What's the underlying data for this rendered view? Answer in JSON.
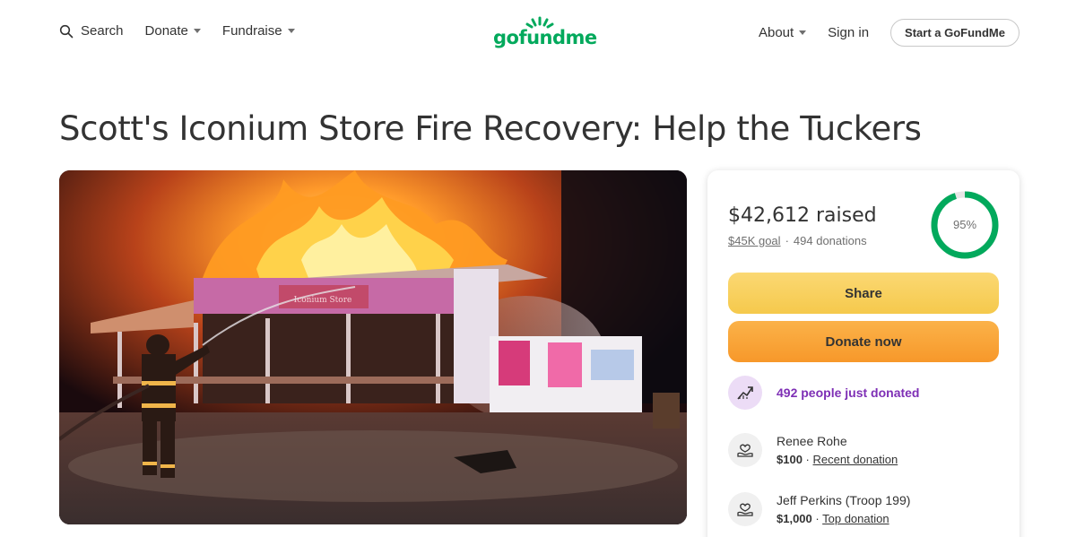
{
  "nav": {
    "search_label": "Search",
    "donate_label": "Donate",
    "fundraise_label": "Fundraise",
    "logo_text": "gofundme",
    "about_label": "About",
    "signin_label": "Sign in",
    "start_label": "Start a GoFundMe"
  },
  "campaign": {
    "title": "Scott's Iconium Store Fire Recovery: Help the Tuckers",
    "store_sign": "Iconium Store"
  },
  "donation_card": {
    "raised_amount": "$42,612",
    "raised_suffix": "raised",
    "goal_label": "$45K goal",
    "donation_count": "494 donations",
    "progress_percent_label": "95%",
    "progress_fraction": 0.95,
    "share_label": "Share",
    "donate_label": "Donate now",
    "trend_text": "492 people just donated",
    "donors": [
      {
        "name": "Renee Rohe",
        "amount": "$100",
        "tag": "Recent donation"
      },
      {
        "name": "Jeff Perkins (Troop 199)",
        "amount": "$1,000",
        "tag": "Top donation"
      }
    ]
  },
  "colors": {
    "brand_green": "#02a95c",
    "share_yellow": "#f5c94c",
    "donate_orange": "#f7982a",
    "trend_purple": "#7e2fb5"
  },
  "icons": [
    "search-icon",
    "caret-down-icon",
    "trend-up-icon",
    "donor-heart-icon"
  ]
}
